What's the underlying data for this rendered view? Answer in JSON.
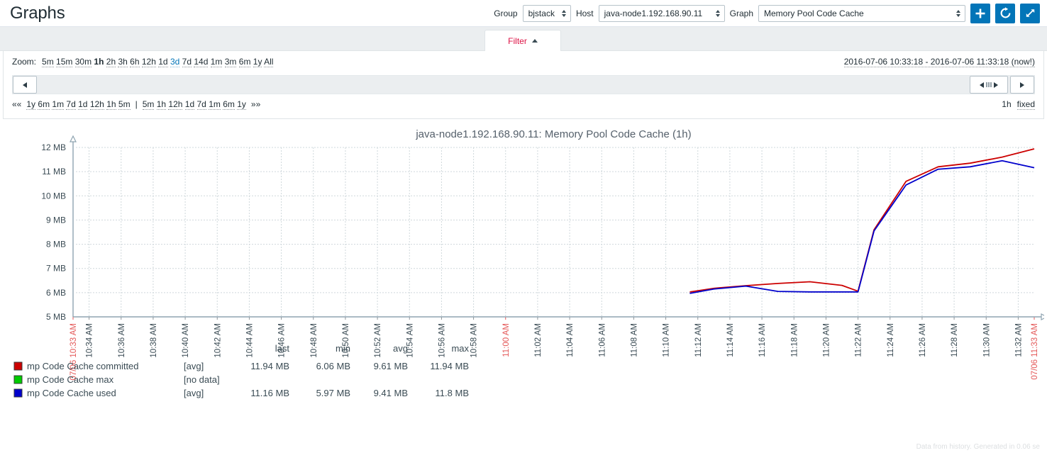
{
  "header": {
    "title": "Graphs",
    "group_label": "Group",
    "group_value": "bjstack",
    "host_label": "Host",
    "host_value": "java-node1.192.168.90.11",
    "graph_label": "Graph",
    "graph_value": "Memory Pool Code Cache",
    "buttons": {
      "add": "plus-icon",
      "refresh": "refresh-icon",
      "fullscreen": "expand-icon"
    }
  },
  "tabs": {
    "filter_label": "Filter",
    "filter_collapse_icon": "triangle-up-icon"
  },
  "filter": {
    "zoom_label": "Zoom:",
    "zoom_links": [
      {
        "label": "5m",
        "state": "normal"
      },
      {
        "label": "15m",
        "state": "normal"
      },
      {
        "label": "30m",
        "state": "normal"
      },
      {
        "label": "1h",
        "state": "bold"
      },
      {
        "label": "2h",
        "state": "normal"
      },
      {
        "label": "3h",
        "state": "normal"
      },
      {
        "label": "6h",
        "state": "normal"
      },
      {
        "label": "12h",
        "state": "normal"
      },
      {
        "label": "1d",
        "state": "normal"
      },
      {
        "label": "3d",
        "state": "active"
      },
      {
        "label": "7d",
        "state": "normal"
      },
      {
        "label": "14d",
        "state": "normal"
      },
      {
        "label": "1m",
        "state": "normal"
      },
      {
        "label": "3m",
        "state": "normal"
      },
      {
        "label": "6m",
        "state": "normal"
      },
      {
        "label": "1y",
        "state": "normal"
      },
      {
        "label": "All",
        "state": "normal"
      }
    ],
    "timerange": "2016-07-06 10:33:18 - 2016-07-06 11:33:18 (now!)",
    "quicklinks_prev_chev": "««",
    "quicklinks_prev": [
      "1y",
      "6m",
      "1m",
      "7d",
      "1d",
      "12h",
      "1h",
      "5m"
    ],
    "quicklinks_separator": "|",
    "quicklinks_next": [
      "5m",
      "1h",
      "12h",
      "1d",
      "7d",
      "1m",
      "6m",
      "1y"
    ],
    "quicklinks_next_chev": "»»",
    "period_value": "1h",
    "period_mode": "fixed"
  },
  "chart_data": {
    "type": "line",
    "title": "java-node1.192.168.90.11: Memory Pool Code Cache (1h)",
    "xlabel": "",
    "ylabel": "",
    "ylim": [
      5,
      12
    ],
    "ytick_labels": [
      "12 MB",
      "11 MB",
      "10 MB",
      "9 MB",
      "8 MB",
      "7 MB",
      "6 MB",
      "5 MB"
    ],
    "ytick_values": [
      12,
      11,
      10,
      9,
      8,
      7,
      6,
      5
    ],
    "grid": true,
    "legend_position": "bottom",
    "x_start_label": "07/06 10:33 AM",
    "x_end_label": "07/06 11:33 AM",
    "xtick_labels": [
      {
        "label": "07/06 10:33 AM",
        "highlight": true
      },
      {
        "label": "10:34 AM",
        "highlight": false
      },
      {
        "label": "10:36 AM",
        "highlight": false
      },
      {
        "label": "10:38 AM",
        "highlight": false
      },
      {
        "label": "10:40 AM",
        "highlight": false
      },
      {
        "label": "10:42 AM",
        "highlight": false
      },
      {
        "label": "10:44 AM",
        "highlight": false
      },
      {
        "label": "10:46 AM",
        "highlight": false
      },
      {
        "label": "10:48 AM",
        "highlight": false
      },
      {
        "label": "10:50 AM",
        "highlight": false
      },
      {
        "label": "10:52 AM",
        "highlight": false
      },
      {
        "label": "10:54 AM",
        "highlight": false
      },
      {
        "label": "10:56 AM",
        "highlight": false
      },
      {
        "label": "10:58 AM",
        "highlight": false
      },
      {
        "label": "11:00 AM",
        "highlight": true
      },
      {
        "label": "11:02 AM",
        "highlight": false
      },
      {
        "label": "11:04 AM",
        "highlight": false
      },
      {
        "label": "11:06 AM",
        "highlight": false
      },
      {
        "label": "11:08 AM",
        "highlight": false
      },
      {
        "label": "11:10 AM",
        "highlight": false
      },
      {
        "label": "11:12 AM",
        "highlight": false
      },
      {
        "label": "11:14 AM",
        "highlight": false
      },
      {
        "label": "11:16 AM",
        "highlight": false
      },
      {
        "label": "11:18 AM",
        "highlight": false
      },
      {
        "label": "11:20 AM",
        "highlight": false
      },
      {
        "label": "11:22 AM",
        "highlight": false
      },
      {
        "label": "11:24 AM",
        "highlight": false
      },
      {
        "label": "11:26 AM",
        "highlight": false
      },
      {
        "label": "11:28 AM",
        "highlight": false
      },
      {
        "label": "11:30 AM",
        "highlight": false
      },
      {
        "label": "11:32 AM",
        "highlight": false
      },
      {
        "label": "07/06 11:33 AM",
        "highlight": true
      }
    ],
    "series": [
      {
        "name": "mp Code Cache committed",
        "color": "#CC0000",
        "x_minutes": [
          38.5,
          40,
          42,
          44,
          46,
          48,
          49,
          50,
          52,
          54,
          56,
          58,
          60
        ],
        "values": [
          6.03,
          6.18,
          6.29,
          6.38,
          6.45,
          6.3,
          6.06,
          8.6,
          10.6,
          11.2,
          11.35,
          11.6,
          11.94
        ]
      },
      {
        "name": "mp Code Cache max",
        "color": "#00CC00",
        "x_minutes": [],
        "values": []
      },
      {
        "name": "mp Code Cache used",
        "color": "#0000CC",
        "x_minutes": [
          38.5,
          40,
          42,
          44,
          46,
          48,
          49,
          50,
          52,
          54,
          56,
          58,
          60
        ],
        "values": [
          5.97,
          6.15,
          6.27,
          6.05,
          6.03,
          6.03,
          6.03,
          8.55,
          10.45,
          11.1,
          11.2,
          11.45,
          11.16
        ]
      }
    ],
    "legend_columns": [
      "last",
      "min",
      "avg",
      "max"
    ],
    "legend_rows": [
      {
        "color": "#CC0000",
        "name": "mp Code Cache committed",
        "func": "[avg]",
        "last": "11.94 MB",
        "min": "6.06 MB",
        "avg": "9.61 MB",
        "max": "11.94 MB"
      },
      {
        "color": "#00CC00",
        "name": "mp Code Cache max",
        "func": "[no data]",
        "last": "",
        "min": "",
        "avg": "",
        "max": ""
      },
      {
        "color": "#0000CC",
        "name": "mp Code Cache used",
        "func": "[avg]",
        "last": "11.16 MB",
        "min": "5.97 MB",
        "avg": "9.41 MB",
        "max": "11.8 MB"
      }
    ]
  },
  "footer": {
    "note": "Data from history. Generated in 0.06 se"
  }
}
